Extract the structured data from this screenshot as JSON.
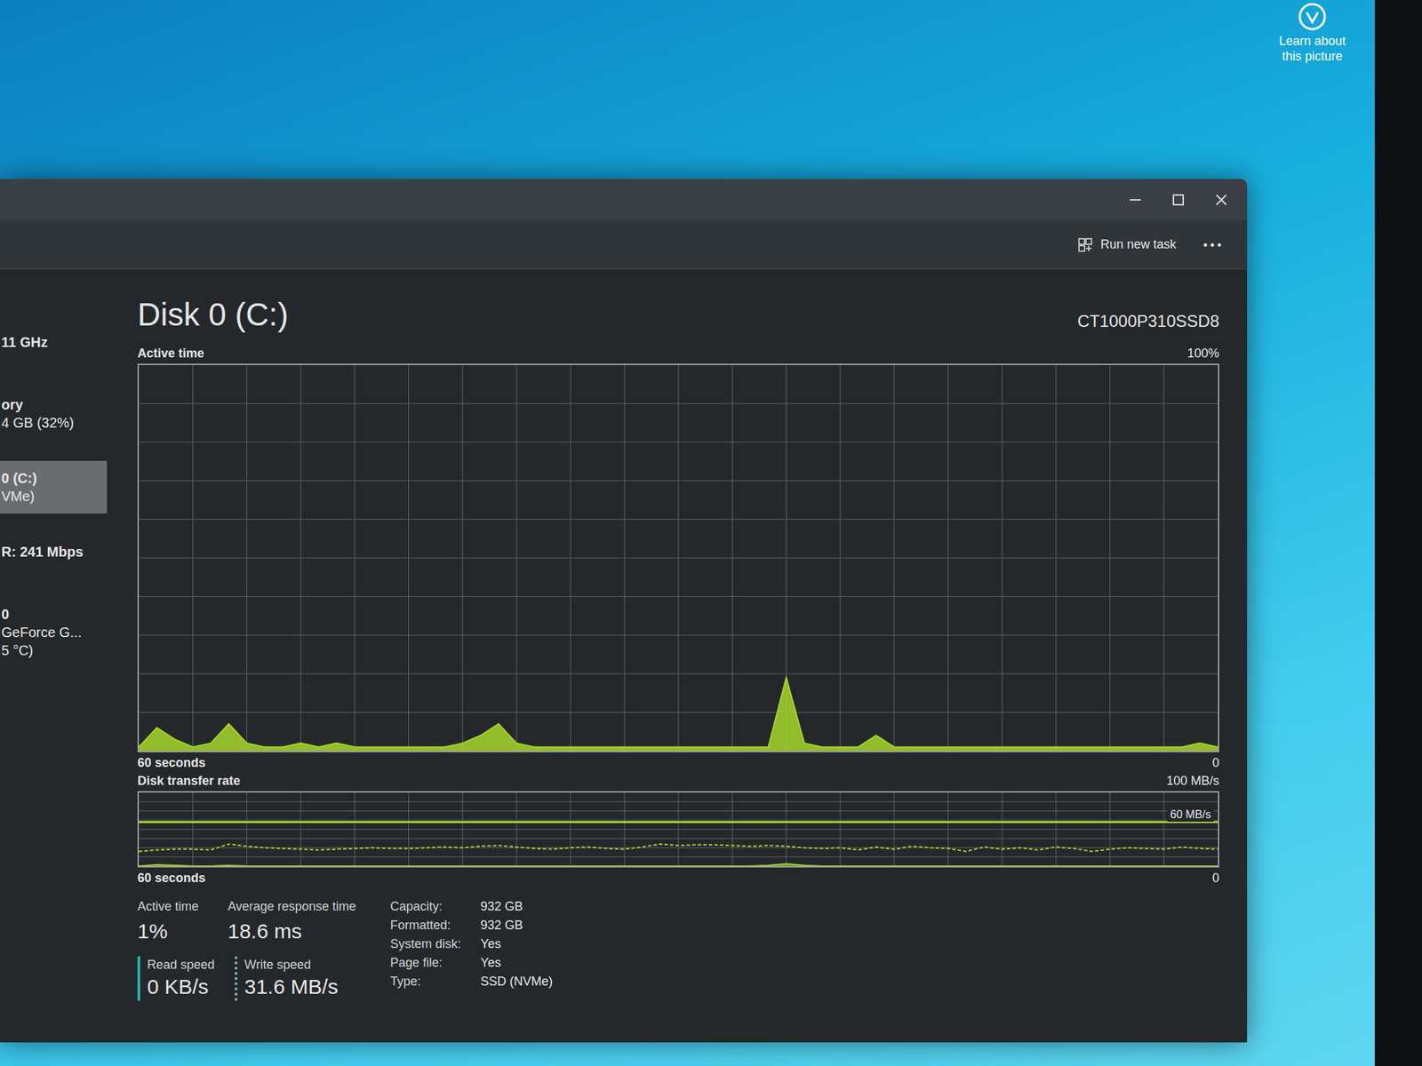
{
  "desktop": {
    "learn_about": [
      "Learn about",
      "this picture"
    ]
  },
  "toolbar": {
    "run_new_task": "Run new task"
  },
  "sidebar": [
    {
      "lines": [
        "11 GHz"
      ],
      "selected": false
    },
    {
      "lines": [
        "ory",
        "4 GB (32%)"
      ],
      "selected": false
    },
    {
      "lines": [
        "0 (C:)",
        "VMe)"
      ],
      "selected": true
    },
    {
      "lines": [
        "R: 241 Mbps"
      ],
      "selected": false
    },
    {
      "lines": [
        "0",
        "GeForce G...",
        "5 °C)"
      ],
      "selected": false
    }
  ],
  "disk": {
    "title": "Disk 0 (C:)",
    "model": "CT1000P310SSD8"
  },
  "active_time_chart": {
    "label": "Active time",
    "max": "100%",
    "span": "60 seconds",
    "min": "0",
    "scale_max": 100,
    "values": [
      1,
      6,
      3,
      1,
      2,
      7,
      2,
      1,
      1,
      2,
      1,
      2,
      1,
      1,
      1,
      1,
      1,
      1,
      2,
      4,
      7,
      2,
      1,
      1,
      1,
      1,
      1,
      1,
      1,
      1,
      1,
      1,
      1,
      1,
      1,
      1,
      19,
      2,
      1,
      1,
      1,
      4,
      1,
      1,
      1,
      1,
      1,
      1,
      1,
      1,
      1,
      1,
      1,
      1,
      1,
      1,
      1,
      1,
      1,
      2,
      1
    ]
  },
  "transfer_chart": {
    "label": "Disk transfer rate",
    "max": "100 MB/s",
    "marker": "60 MB/s",
    "span": "60 seconds",
    "min": "0",
    "scale_max": 100,
    "marker_value": 60,
    "series": [
      {
        "kind": "dashed",
        "values": [
          20,
          22,
          23,
          23,
          22,
          30,
          27,
          25,
          24,
          23,
          22,
          23,
          24,
          25,
          24,
          24,
          25,
          26,
          25,
          27,
          28,
          26,
          24,
          23,
          25,
          26,
          24,
          23,
          26,
          30,
          28,
          29,
          29,
          28,
          27,
          28,
          27,
          25,
          24,
          25,
          22,
          26,
          23,
          27,
          25,
          24,
          20,
          26,
          23,
          25,
          22,
          26,
          24,
          20,
          23,
          25,
          24,
          23,
          26,
          24,
          23
        ]
      },
      {
        "kind": "solid",
        "values": [
          0,
          2,
          1,
          0,
          0,
          1,
          0,
          0,
          0,
          0,
          0,
          0,
          0,
          0,
          0,
          0,
          0,
          0,
          0,
          0,
          0,
          0,
          0,
          0,
          0,
          0,
          0,
          0,
          0,
          0,
          0,
          0,
          0,
          0,
          0,
          1,
          3,
          1,
          0,
          0,
          0,
          0,
          0,
          0,
          0,
          0,
          0,
          0,
          0,
          0,
          0,
          0,
          0,
          0,
          0,
          0,
          0,
          0,
          0,
          0,
          0
        ]
      }
    ]
  },
  "stats": [
    {
      "label": "Active time",
      "value": "1%"
    },
    {
      "label": "Average response time",
      "value": "18.6 ms"
    }
  ],
  "speeds": [
    {
      "label": "Read speed",
      "value": "0 KB/s",
      "kind": "solid"
    },
    {
      "label": "Write speed",
      "value": "31.6 MB/s",
      "kind": "dotted"
    }
  ],
  "details": [
    {
      "key": "Capacity:",
      "value": "932 GB"
    },
    {
      "key": "Formatted:",
      "value": "932 GB"
    },
    {
      "key": "System disk:",
      "value": "Yes"
    },
    {
      "key": "Page file:",
      "value": "Yes"
    },
    {
      "key": "Type:",
      "value": "SSD (NVMe)"
    }
  ]
}
